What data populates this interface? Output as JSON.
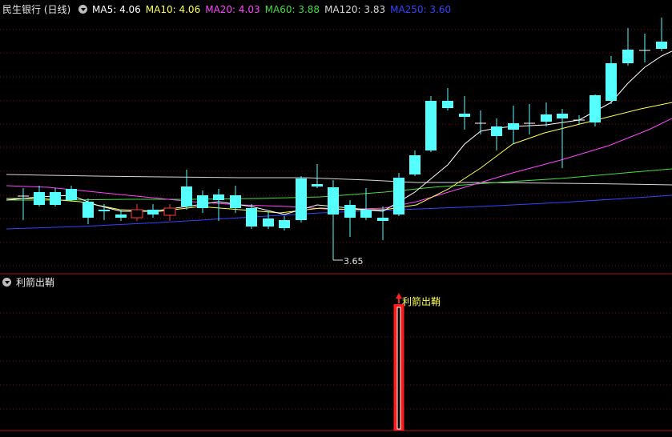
{
  "main_panel": {
    "stock_title": "民生银行 (日线)",
    "ma_labels": [
      {
        "text": "MA5: 4.06",
        "color": "#ffffff"
      },
      {
        "text": "MA10: 4.06",
        "color": "#ffff55"
      },
      {
        "text": "MA20: 4.03",
        "color": "#ff44ff"
      },
      {
        "text": "MA60: 3.88",
        "color": "#44dd44"
      },
      {
        "text": "MA120: 3.83",
        "color": "#d8d8d8"
      },
      {
        "text": "MA250: 3.60",
        "color": "#3344ff"
      }
    ],
    "low_marker": "3.65"
  },
  "sub_panel": {
    "indicator_title": "利箭出鞘",
    "signal_label": "利箭出鞘"
  },
  "colors": {
    "up": "#ff3c3c",
    "down": "#55ffff",
    "grid": "#7a1010",
    "signal_label": "#ffff55"
  },
  "icons": [
    "collapse-icon",
    "collapse-icon",
    "arrow-up-icon"
  ]
}
